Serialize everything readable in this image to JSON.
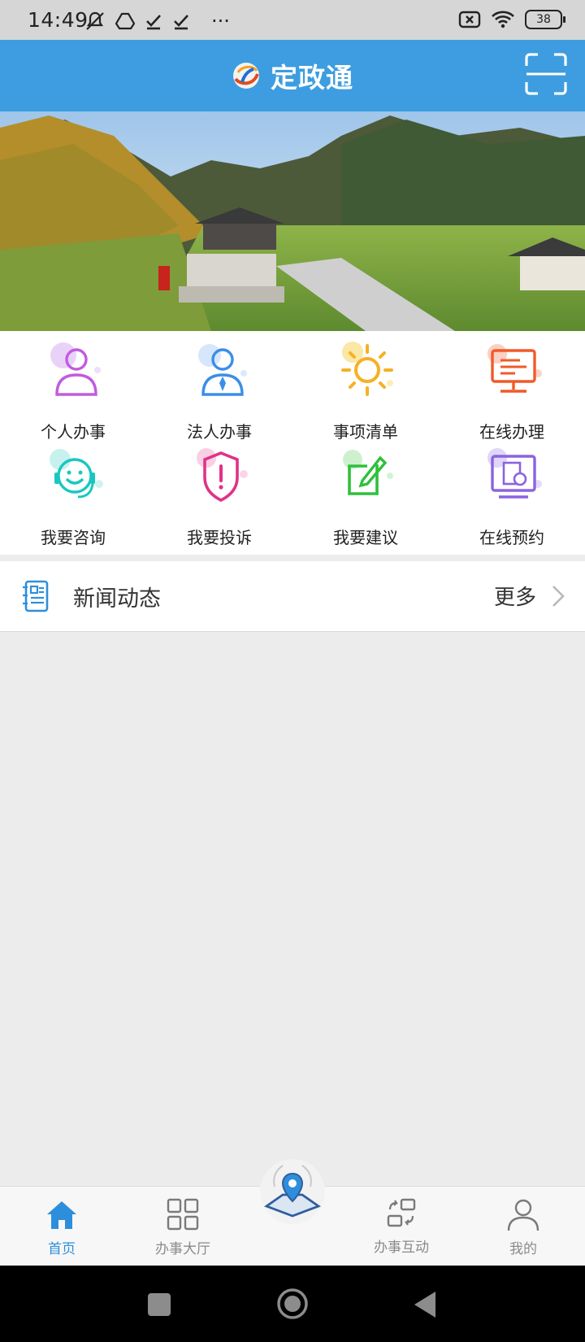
{
  "status_bar": {
    "time": "14:49",
    "dots": "···",
    "battery": "38"
  },
  "header": {
    "title": "定政通",
    "logo_icon": "app-logo-icon",
    "scan_icon": "scan-icon",
    "color": "#3d9de0"
  },
  "banner": {
    "description_icon": "landscape-banner"
  },
  "services": [
    {
      "label": "个人办事",
      "icon": "person-icon",
      "color": "#c15be0"
    },
    {
      "label": "法人办事",
      "icon": "legal-person-icon",
      "color": "#3b8ee8"
    },
    {
      "label": "事项清单",
      "icon": "sun-icon",
      "color": "#f5b125"
    },
    {
      "label": "在线办理",
      "icon": "monitor-icon",
      "color": "#f05a28"
    },
    {
      "label": "我要咨询",
      "icon": "headset-icon",
      "color": "#18c8c0"
    },
    {
      "label": "我要投诉",
      "icon": "shield-alert-icon",
      "color": "#e0328a"
    },
    {
      "label": "我要建议",
      "icon": "edit-icon",
      "color": "#2fc03c"
    },
    {
      "label": "在线预约",
      "icon": "calendar-screen-icon",
      "color": "#8b63e0"
    }
  ],
  "news": {
    "title": "新闻动态",
    "more": "更多"
  },
  "bottom_nav": {
    "items": [
      {
        "label": "首页",
        "icon": "home-icon",
        "active": true
      },
      {
        "label": "办事大厅",
        "icon": "grid-icon",
        "active": false
      },
      {
        "label": "",
        "icon": "map-location-icon",
        "active": false
      },
      {
        "label": "办事互动",
        "icon": "interaction-icon",
        "active": false
      },
      {
        "label": "我的",
        "icon": "user-icon",
        "active": false
      }
    ]
  },
  "colors": {
    "accent": "#3d9de0",
    "nav_active": "#2d8fdc",
    "nav_inactive": "#8a8a8a",
    "background": "#ececec"
  }
}
